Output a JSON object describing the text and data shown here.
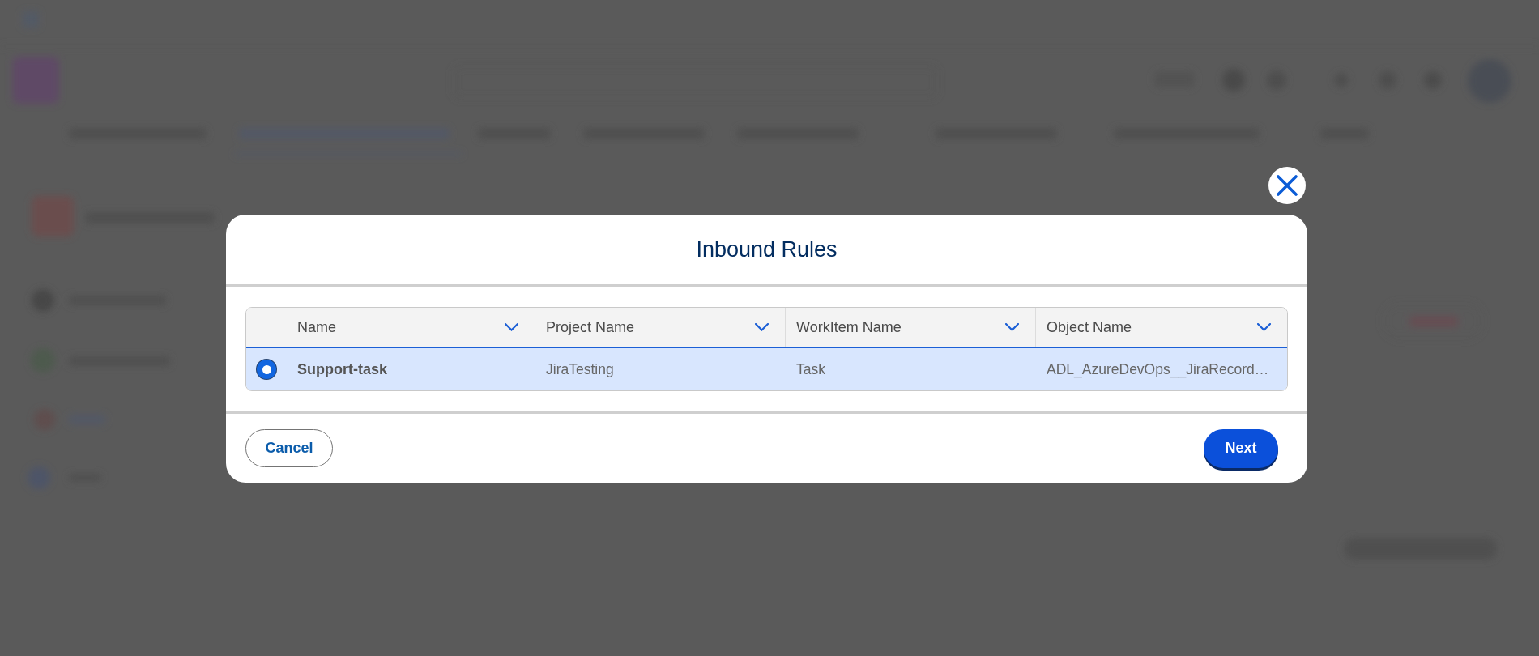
{
  "dialog": {
    "title": "Inbound Rules"
  },
  "table": {
    "columns": [
      "Name",
      "Project Name",
      "WorkItem Name",
      "Object Name"
    ],
    "rows": [
      {
        "selected": true,
        "cells": [
          "Support-task",
          "JiraTesting",
          "Task",
          "ADL_AzureDevOps__JiraRecord…"
        ]
      }
    ]
  },
  "buttons": [
    {
      "label": "Cancel",
      "kind": "secondary"
    },
    {
      "label": "Next",
      "kind": "primary"
    }
  ]
}
